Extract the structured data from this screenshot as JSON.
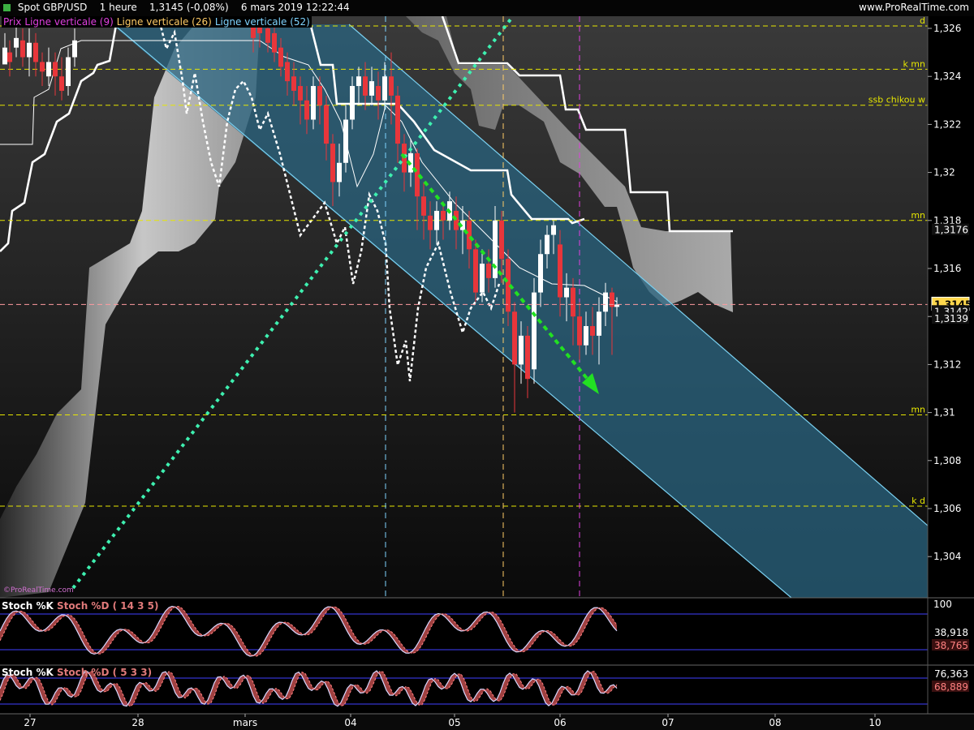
{
  "header": {
    "title": "Spot GBP/USD",
    "timeframe": "1 heure",
    "price": "1,3145 (-0,08%)",
    "datetime": "6 mars 2019 12:22:44",
    "site": "www.ProRealTime.com"
  },
  "legend": {
    "prix": "Prix",
    "line1": "Ligne verticale (9)",
    "line2": "Ligne verticale (26)",
    "line3": "Ligne verticale (52)"
  },
  "copyright": "©ProRealTime.com",
  "stoch1": {
    "k": "Stoch %K",
    "d": "Stoch %D ( 14 3 5)",
    "value_k": "38,918",
    "value_d": "38,765",
    "top_label": "100"
  },
  "stoch2": {
    "k": "Stoch %K",
    "d": "Stoch %D ( 5 3 3)",
    "value_k": "76,363",
    "value_d": "68,889"
  },
  "colors": {
    "up": "#ffffff",
    "down": "#e8363b",
    "channel": "#2e6e86",
    "level": "#e6e600",
    "cursor": "#ffd84d"
  },
  "chart_data": {
    "type": "candlestick",
    "instrument": "Spot GBP/USD",
    "ylim": [
      1.3027,
      1.3266
    ],
    "y_ticks": [
      "1,326",
      "1,324",
      "1,322",
      "1,32",
      "1,318",
      "1,316",
      "1,314",
      "1,312",
      "1,31",
      "1,308",
      "1,306",
      "1,304"
    ],
    "x_ticks": [
      "27",
      "28",
      "mars",
      "04",
      "05",
      "06",
      "07",
      "08",
      "10"
    ],
    "levels": [
      {
        "label": "d",
        "value": 1.3261
      },
      {
        "label": "k mn",
        "value": 1.3243
      },
      {
        "label": "ssb chikou w",
        "value": 1.3228
      },
      {
        "label": "mn",
        "value": 1.318
      },
      {
        "label": "mn",
        "value": 1.3099
      },
      {
        "label": "k d",
        "value": 1.3061
      }
    ],
    "price_labels": [
      {
        "text": "1,3176",
        "value": 1.3176
      },
      {
        "text": "1,3145",
        "value": 1.3145,
        "highlight": true
      },
      {
        "text": "1,3142",
        "value": 1.3142
      },
      {
        "text": "1,3139",
        "value": 1.3139
      }
    ],
    "current_price": 1.3145
  }
}
